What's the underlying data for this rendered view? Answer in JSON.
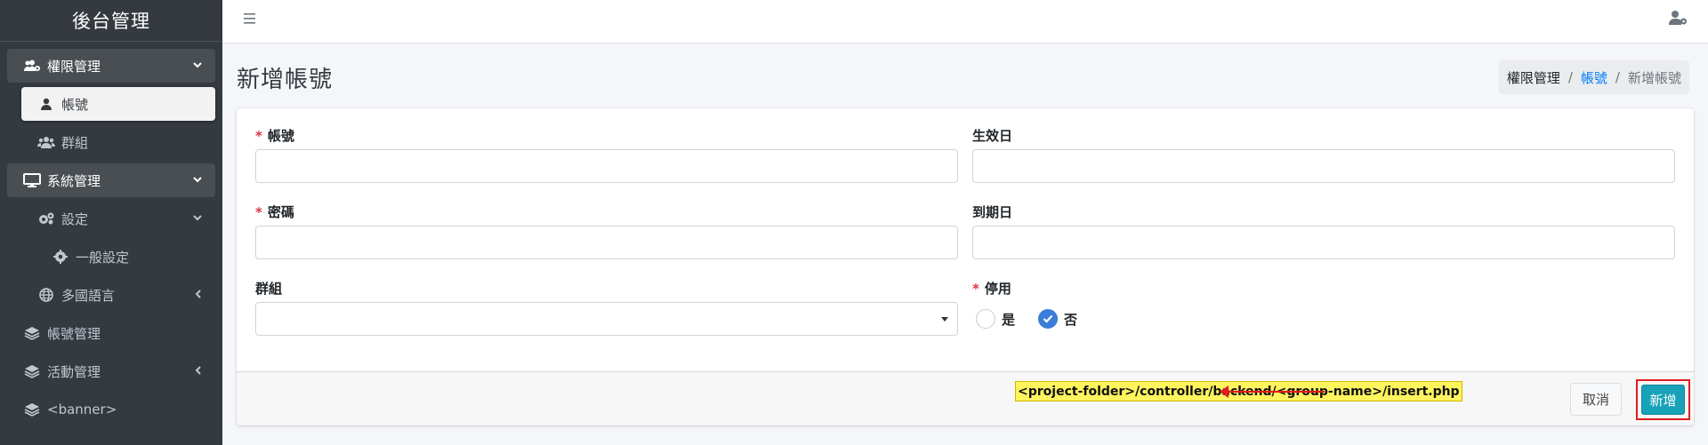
{
  "brand": {
    "title": "後台管理"
  },
  "sidebar": {
    "items": [
      {
        "label": "權限管理",
        "icon": "users-cog-icon"
      },
      {
        "label": "帳號",
        "icon": "user-icon"
      },
      {
        "label": "群組",
        "icon": "users-icon"
      },
      {
        "label": "系統管理",
        "icon": "desktop-icon"
      },
      {
        "label": "設定",
        "icon": "cogs-icon"
      },
      {
        "label": "一般設定",
        "icon": "cog-icon"
      },
      {
        "label": "多國語言",
        "icon": "globe-icon"
      },
      {
        "label": "帳號管理",
        "icon": "layers-icon"
      },
      {
        "label": "活動管理",
        "icon": "layers-icon"
      },
      {
        "label": "<banner>",
        "icon": "layers-icon"
      }
    ]
  },
  "page": {
    "title": "新增帳號"
  },
  "breadcrumb": {
    "root": "權限管理",
    "sep": "/",
    "link": "帳號",
    "current": "新增帳號"
  },
  "form": {
    "required_mark": "*",
    "account": {
      "label": "帳號",
      "value": ""
    },
    "start_date": {
      "label": "生效日",
      "value": ""
    },
    "password": {
      "label": "密碼",
      "value": ""
    },
    "end_date": {
      "label": "到期日",
      "value": ""
    },
    "group": {
      "label": "群組",
      "selected": ""
    },
    "disabled": {
      "label": "停用",
      "options": [
        "是",
        "否"
      ],
      "selected": "否"
    }
  },
  "footer": {
    "annotation": "<project-folder>/controller/backend/<group-name>/insert.php",
    "cancel_label": "取消",
    "submit_label": "新增"
  },
  "colors": {
    "sidebar_bg": "#343a40",
    "primary": "#007bff",
    "submit": "#17a2b8",
    "required": "#dc3545",
    "annotation_bg": "#fff45e",
    "highlight_red": "#e01d1d"
  }
}
